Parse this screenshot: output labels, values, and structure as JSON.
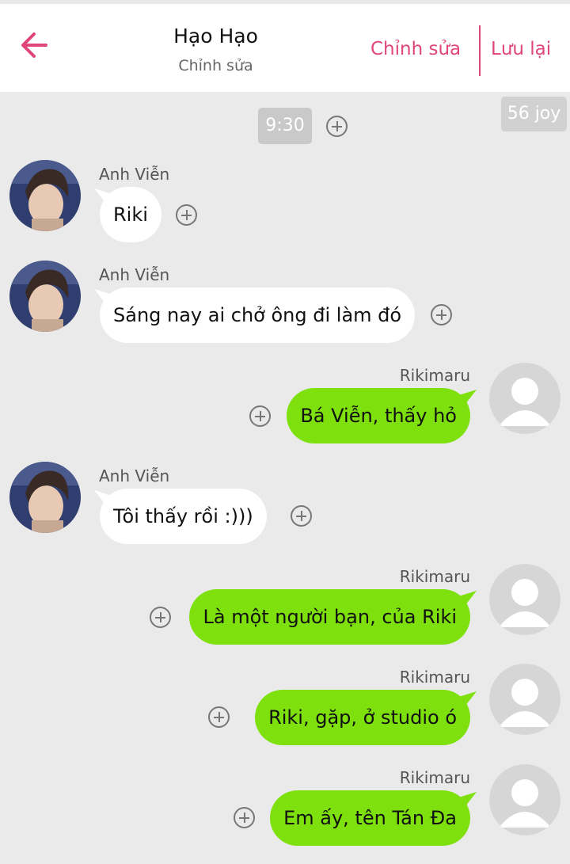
{
  "header": {
    "back_icon": "arrow-left-icon",
    "title": "Hạo Hạo",
    "subtitle": "Chỉnh sửa",
    "edit_label": "Chỉnh sửa",
    "save_label": "Lưu lại",
    "accent_color": "#e0457b"
  },
  "chat": {
    "time_label": "9:30",
    "joy_badge": "56 joy",
    "incoming_bubble_color": "#ffffff",
    "outgoing_bubble_color": "#7ee10e",
    "messages": [
      {
        "sender": "Anh Viễn",
        "text": "Riki",
        "side": "left"
      },
      {
        "sender": "Anh Viễn",
        "text": "Sáng nay ai chở ông đi làm đó",
        "side": "left"
      },
      {
        "sender": "Rikimaru",
        "text": "Bá Viễn, thấy hỏ",
        "side": "right"
      },
      {
        "sender": "Anh Viễn",
        "text": "Tôi thấy rồi :)))",
        "side": "left"
      },
      {
        "sender": "Rikimaru",
        "text": "Là một người bạn, của Riki",
        "side": "right"
      },
      {
        "sender": "Rikimaru",
        "text": "Riki, gặp, ở studio ó",
        "side": "right"
      },
      {
        "sender": "Rikimaru",
        "text": "Em ấy, tên Tán Đa",
        "side": "right"
      }
    ]
  }
}
